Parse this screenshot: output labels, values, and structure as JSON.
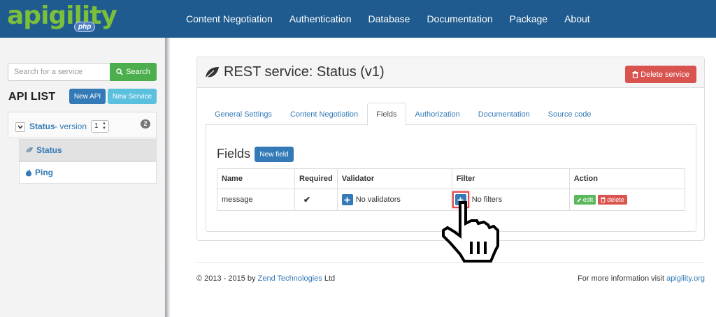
{
  "brand": {
    "logo_text": "apigility",
    "logo_badge": "php"
  },
  "nav": {
    "items": [
      "Content Negotiation",
      "Authentication",
      "Database",
      "Documentation",
      "Package",
      "About"
    ]
  },
  "sidebar": {
    "search_placeholder": "Search for a service",
    "search_button": "Search",
    "title": "API LIST",
    "new_api": "New API",
    "new_service": "New Service",
    "api": {
      "name": "Status",
      "version_label": "- version",
      "version_value": "1",
      "service_count": "2"
    },
    "services": [
      {
        "label": "Status",
        "active": true,
        "icon": "leaf-icon"
      },
      {
        "label": "Ping",
        "active": false,
        "icon": "fire-icon"
      }
    ]
  },
  "panel": {
    "title": "REST service: Status (v1)",
    "title_icon": "leaf-icon",
    "delete_service": "Delete service",
    "tabs": [
      "General Settings",
      "Content Negotiation",
      "Fields",
      "Authorization",
      "Documentation",
      "Source code"
    ],
    "active_tab": "Fields"
  },
  "fields": {
    "title": "Fields",
    "new_field": "New field",
    "columns": [
      "Name",
      "Required",
      "Validator",
      "Filter",
      "Action"
    ],
    "rows": [
      {
        "name": "message",
        "required": "✔",
        "validator": "No validators",
        "filter": "No filters",
        "edit": "edit",
        "delete": "delete"
      }
    ]
  },
  "footer": {
    "copyright_prefix": "© 2013 - 2015 by",
    "company": "Zend Technologies",
    "company_suffix": "Ltd",
    "more_info": "For more information visit",
    "site": "apigility.org"
  },
  "colors": {
    "navbar": "#1f5b8e",
    "primary": "#337ab7",
    "success": "#5cb85c",
    "danger": "#d9534f",
    "info": "#5bc0de",
    "logo_green": "#7cbf3b",
    "highlight": "#e34c4c"
  },
  "cursor": {
    "icon": "hand-pointer-icon"
  }
}
